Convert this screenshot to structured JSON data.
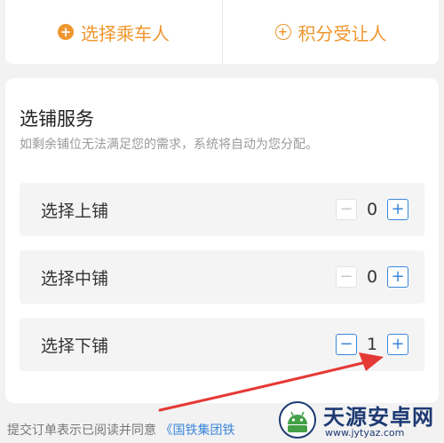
{
  "passenger_actions": {
    "select_passenger": "选择乘车人",
    "points_transferee": "积分受让人"
  },
  "berth_service": {
    "title": "选铺服务",
    "description": "如剩余铺位无法满足您的需求，系统将自动为您分配。",
    "rows": [
      {
        "label": "选择上铺",
        "count": "0"
      },
      {
        "label": "选择中铺",
        "count": "0"
      },
      {
        "label": "选择下铺",
        "count": "1"
      }
    ]
  },
  "footer": {
    "text": "提交订单表示已阅读并同意",
    "link": "《国铁集团铁"
  },
  "watermark": {
    "title": "天源安卓网",
    "url": "www.jytyaz.com"
  },
  "colors": {
    "accent_orange": "#f0962e",
    "accent_blue": "#3a86d9",
    "annotation_red": "#e53935"
  }
}
